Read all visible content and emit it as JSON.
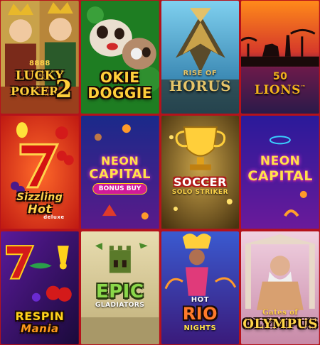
{
  "tiles": [
    {
      "id": "lucky-poker",
      "line1": "8888",
      "line2": "LUCKY",
      "line3": "POKER",
      "badge": "2",
      "colors": {
        "bg": "#b4542a",
        "accent": "#ffd54a"
      }
    },
    {
      "id": "okie-doggie",
      "line1": "OKIE",
      "line2": "DOGGIE",
      "colors": {
        "bg": "#1f7a1f",
        "accent": "#ffcf3a"
      }
    },
    {
      "id": "rise-of-horus",
      "line1": "RISE OF",
      "line2": "HORUS",
      "colors": {
        "bg": "#2fa0d0",
        "accent": "#e6c56a"
      }
    },
    {
      "id": "50-lions",
      "line1": "50",
      "line2": "LIONS",
      "tm": "™",
      "colors": {
        "bg": "#3a1a5a",
        "accent": "#f2b31c"
      }
    },
    {
      "id": "sizzling-hot",
      "line1": "Sizzling",
      "line2": "Hot",
      "line3": "deluxe",
      "colors": {
        "bg": "#e0321b",
        "accent": "#ffd34a"
      }
    },
    {
      "id": "neon-capital-bonus",
      "line1": "NEON",
      "line2": "CAPITAL",
      "pill": "BONUS BUY",
      "colors": {
        "bg": "#2a1a6a",
        "accent": "#ffe14a"
      }
    },
    {
      "id": "soccer",
      "line1": "SOCCER",
      "line2": "SOLO STRIKER",
      "colors": {
        "bg": "#6e4e1a",
        "accent": "#ffd54a"
      }
    },
    {
      "id": "neon-capital",
      "line1": "NEON",
      "line2": "CAPITAL",
      "colors": {
        "bg": "#321a7a",
        "accent": "#ffe14a"
      }
    },
    {
      "id": "respin-mania",
      "line1": "RESPIN",
      "line2": "Mania",
      "colors": {
        "bg": "#2a0e4a",
        "accent": "#ffd21a"
      }
    },
    {
      "id": "epic-gladiators",
      "line1": "EPIC",
      "line2": "GLADIATORS",
      "colors": {
        "bg": "#e8ddb0",
        "accent": "#76c23a"
      }
    },
    {
      "id": "hot-rio-nights",
      "line1": "HOT",
      "line2": "RIO",
      "line3": "NIGHTS",
      "colors": {
        "bg": "#3a2a9a",
        "accent": "#ff6a2a"
      }
    },
    {
      "id": "gates-of-olympus",
      "line1": "Gates of",
      "line2": "OLYMPUS",
      "colors": {
        "bg": "#d8a8c8",
        "accent": "#ffd54a"
      }
    }
  ]
}
